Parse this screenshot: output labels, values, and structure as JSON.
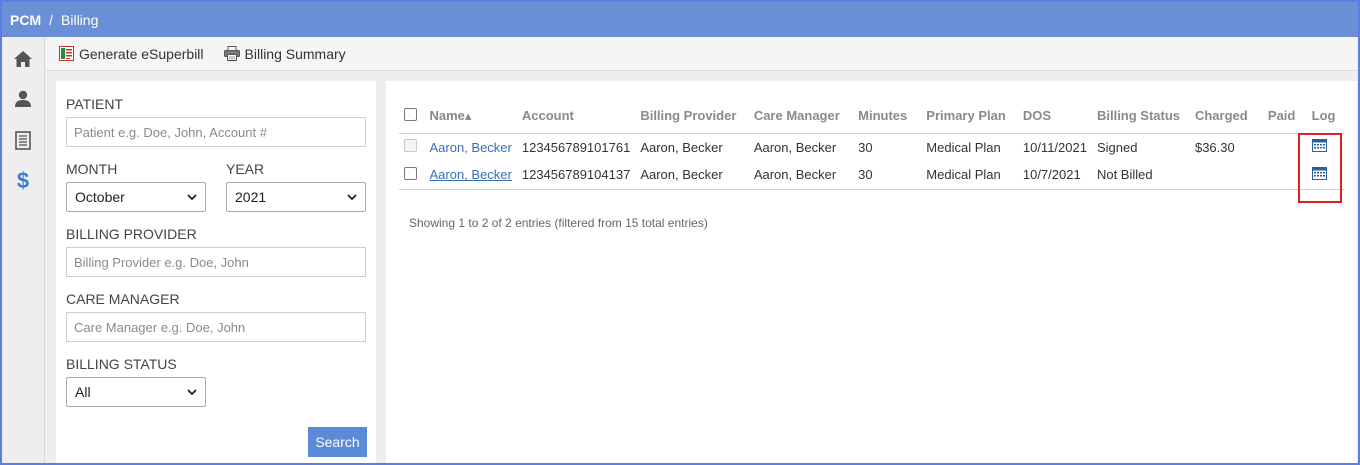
{
  "header": {
    "brand": "PCM",
    "separator": "/",
    "section": "Billing"
  },
  "sidebar": {
    "items": [
      {
        "icon": "home-icon"
      },
      {
        "icon": "user-icon"
      },
      {
        "icon": "document-icon"
      },
      {
        "icon": "dollar-icon",
        "label": "$",
        "active": true
      }
    ]
  },
  "toolbar": {
    "generate_label": "Generate eSuperbill",
    "summary_label": "Billing Summary"
  },
  "filters": {
    "patient_label": "PATIENT",
    "patient_placeholder": "Patient e.g. Doe, John, Account #",
    "month_label": "MONTH",
    "month_value": "October",
    "year_label": "YEAR",
    "year_value": "2021",
    "provider_label": "BILLING PROVIDER",
    "provider_placeholder": "Billing Provider e.g. Doe, John",
    "manager_label": "CARE MANAGER",
    "manager_placeholder": "Care Manager e.g. Doe, John",
    "status_label": "BILLING STATUS",
    "status_value": "All",
    "search_label": "Search"
  },
  "table": {
    "columns": [
      "Name▴",
      "Account",
      "Billing Provider",
      "Care Manager",
      "Minutes",
      "Primary Plan",
      "DOS",
      "Billing Status",
      "Charged",
      "Paid",
      "Log"
    ],
    "rows": [
      {
        "name": "Aaron, Becker",
        "account": "123456789101761",
        "provider": "Aaron, Becker",
        "manager": "Aaron, Becker",
        "minutes": "30",
        "plan": "Medical Plan",
        "dos": "10/11/2021",
        "status": "Signed",
        "charged": "$36.30",
        "paid": ""
      },
      {
        "name": "Aaron, Becker",
        "account": "123456789104137",
        "provider": "Aaron, Becker",
        "manager": "Aaron, Becker",
        "minutes": "30",
        "plan": "Medical Plan",
        "dos": "10/7/2021",
        "status": "Not Billed",
        "charged": "",
        "paid": ""
      }
    ],
    "footer": "Showing 1 to 2 of 2 entries (filtered from 15 total entries)"
  },
  "colors": {
    "accent": "#6a8fd6",
    "link": "#3a6fb0",
    "highlight": "#e02020",
    "button": "#5b8ad6"
  }
}
